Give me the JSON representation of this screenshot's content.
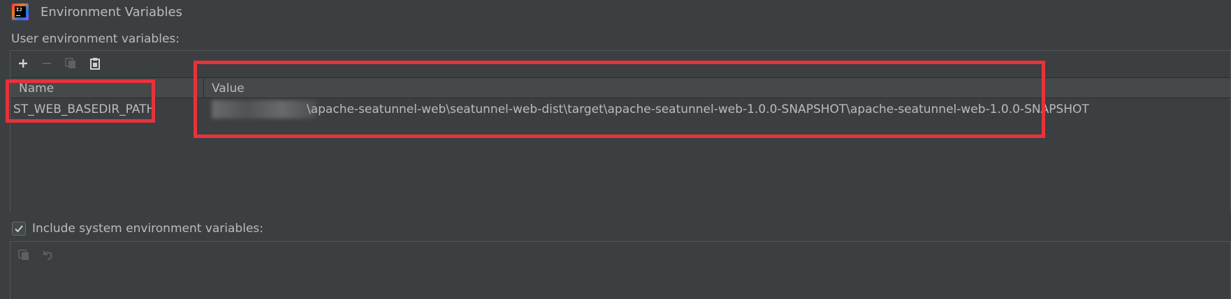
{
  "window": {
    "title": "Environment Variables",
    "app_icon_text": "IJ"
  },
  "section": {
    "label": "User environment variables:"
  },
  "toolbar": {
    "icons": [
      "add-icon",
      "remove-icon",
      "copy-icon",
      "paste-icon"
    ]
  },
  "table": {
    "columns": [
      "Name",
      "Value"
    ],
    "rows": [
      {
        "name": "ST_WEB_BASEDIR_PATH",
        "value": "\\apache-seatunnel-web\\seatunnel-web-dist\\target\\apache-seatunnel-web-1.0.0-SNAPSHOT\\apache-seatunnel-web-1.0.0-SNAPSHOT"
      }
    ]
  },
  "include_system": {
    "label": "Include system environment variables:",
    "checked": true
  },
  "bottom_toolbar": {
    "icons": [
      "copy-icon",
      "undo-icon"
    ]
  },
  "colors": {
    "background": "#3c3f41",
    "text": "#bbbbbb",
    "annotation": "#e8323a",
    "header_bg": "#45494a"
  }
}
